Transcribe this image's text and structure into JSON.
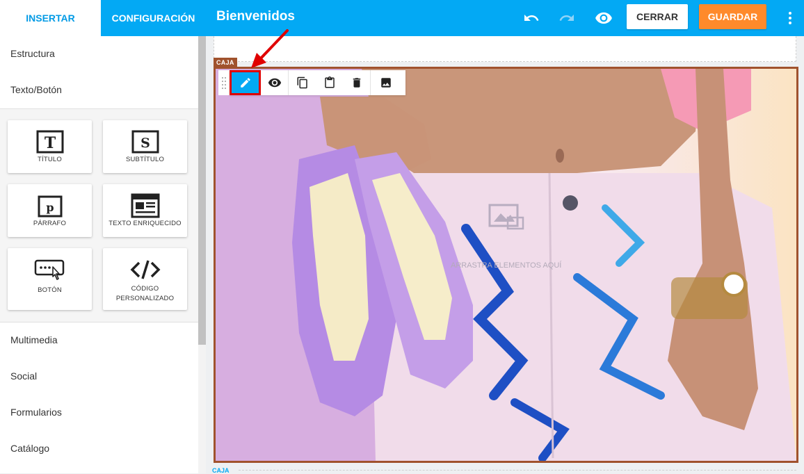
{
  "sidebar": {
    "tabs": [
      {
        "label": "INSERTAR"
      },
      {
        "label": "CONFIGURACIÓN"
      }
    ],
    "categories": {
      "estructura": "Estructura",
      "texto_boton": "Texto/Botón",
      "multimedia": "Multimedia",
      "social": "Social",
      "formularios": "Formularios",
      "catalogo": "Catálogo"
    },
    "tiles": {
      "titulo": {
        "label": "TÍTULO",
        "glyph": "T"
      },
      "subtitulo": {
        "label": "SUBTÍTULO",
        "glyph": "S"
      },
      "parrafo": {
        "label": "PÁRRAFO",
        "glyph": "p"
      },
      "texto_enriquecido": {
        "label": "TEXTO ENRIQUECIDO"
      },
      "boton": {
        "label": "BOTÓN"
      },
      "codigo_line1": "CÓDIGO",
      "codigo_line2": "PERSONALIZADO"
    }
  },
  "topbar": {
    "title": "Bienvenidos",
    "close_label": "CERRAR",
    "save_label": "GUARDAR"
  },
  "canvas": {
    "caja_label": "CAJA",
    "bottom_caja_label": "CAJA",
    "dropzone_hint": "ARRASTRA ELEMENTOS AQUÍ"
  },
  "colors": {
    "primary": "#03a9f4",
    "save": "#ff8a2b",
    "selection": "#a0522d",
    "highlight": "#e00000"
  }
}
